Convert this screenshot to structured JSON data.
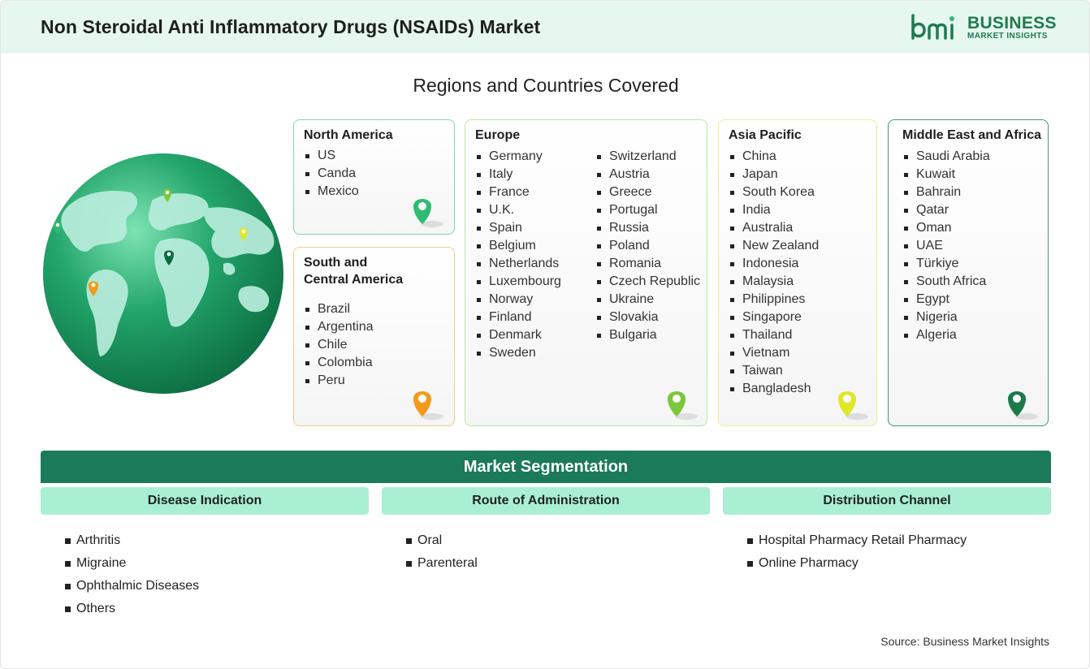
{
  "header": {
    "title": "Non Steroidal Anti Inflammatory Drugs (NSAIDs) Market",
    "logo_line1": "BUSINESS",
    "logo_line2": "MARKET INSIGHTS"
  },
  "regions_title": "Regions and Countries Covered",
  "regions": {
    "north_america": {
      "title": "North America",
      "countries": [
        "US",
        "Canda",
        "Mexico"
      ],
      "accent": "#7fd8a6",
      "pin_color": "#2ebc72"
    },
    "south_central_america": {
      "title_line1": "South and",
      "title_line2": "Central America",
      "countries": [
        "Brazil",
        "Argentina",
        "Chile",
        "Colombia",
        "Peru"
      ],
      "accent": "#f6c98a",
      "pin_color": "#f39a1c"
    },
    "europe": {
      "title": "Europe",
      "countries_col1": [
        "Germany",
        "Italy",
        "France",
        "U.K.",
        "Spain",
        "Belgium",
        "Netherlands",
        "Luxembourg",
        "Norway",
        "Finland",
        "Denmark",
        "Sweden"
      ],
      "countries_col2": [
        "Switzerland",
        "Austria",
        "Greece",
        "Portugal",
        "Russia",
        "Poland",
        "Romania",
        "Czech Republic",
        "Ukraine",
        "Slovakia",
        "Bulgaria"
      ],
      "accent": "#b7e8a3",
      "pin_color": "#7cc73b"
    },
    "asia_pacific": {
      "title": "Asia Pacific",
      "countries": [
        "China",
        "Japan",
        "South Korea",
        "India",
        "Australia",
        "New Zealand",
        "Indonesia",
        "Malaysia",
        "Philippines",
        "Singapore",
        "Thailand",
        "Vietnam",
        "Taiwan",
        "Bangladesh"
      ],
      "accent": "#ecef8e",
      "pin_color": "#dfe72a"
    },
    "middle_east_africa": {
      "title": "Middle East and Africa",
      "countries": [
        "Saudi Arabia",
        "Kuwait",
        "Bahrain",
        "Qatar",
        "Oman",
        "UAE",
        "Türkiye",
        "South Africa",
        "Egypt",
        "Nigeria",
        "Algeria"
      ],
      "accent": "#3e9a70",
      "pin_color": "#1b7a4a"
    }
  },
  "segmentation": {
    "title": "Market Segmentation",
    "columns": [
      {
        "title": "Disease Indication",
        "items": [
          "Arthritis",
          "Migraine",
          "Ophthalmic Diseases",
          "Others"
        ]
      },
      {
        "title": "Route of Administration",
        "items": [
          "Oral",
          "Parenteral"
        ]
      },
      {
        "title": "Distribution Channel",
        "items": [
          "Hospital Pharmacy Retail Pharmacy",
          "Online Pharmacy"
        ]
      }
    ]
  },
  "source": "Source: Business Market Insights",
  "colors": {
    "header_bg": "#e6f7ef",
    "brand_green": "#1f7a4f",
    "segment_header": "#1b7a5a",
    "segment_tab": "#a9f0d3"
  }
}
